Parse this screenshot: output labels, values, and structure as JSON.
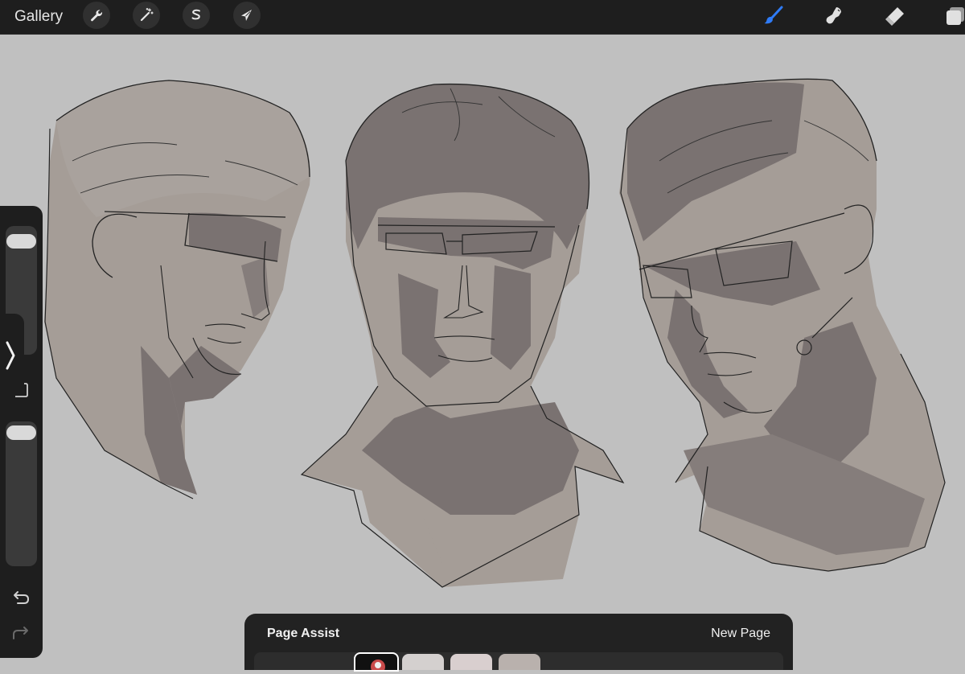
{
  "toolbar": {
    "gallery_label": "Gallery",
    "left_tools": [
      {
        "name": "actions",
        "icon": "wrench-icon"
      },
      {
        "name": "adjustments",
        "icon": "magic-wand-icon"
      },
      {
        "name": "selection",
        "icon": "selection-s-icon"
      },
      {
        "name": "transform",
        "icon": "arrow-cursor-icon"
      }
    ],
    "right_tools": [
      {
        "name": "brush",
        "icon": "brush-icon",
        "active": true
      },
      {
        "name": "smudge",
        "icon": "smudge-icon"
      },
      {
        "name": "eraser",
        "icon": "eraser-icon"
      },
      {
        "name": "layers",
        "icon": "layers-icon"
      }
    ],
    "accent_color": "#2f7bf6"
  },
  "sidebar": {
    "brush_size_level": 0.0,
    "opacity_level": 0.0,
    "expand_icon": "chevron-right-icon",
    "modify_icon": "square-modify-icon",
    "undo_icon": "undo-icon",
    "redo_icon": "redo-icon"
  },
  "page_assist": {
    "title": "Page Assist",
    "new_page_label": "New Page",
    "thumbnails": 4
  },
  "canvas": {
    "background_color": "#c0c0c0",
    "skin_color": "#a59d97",
    "shadow_color": "#7a7271",
    "line_color": "#222222"
  }
}
